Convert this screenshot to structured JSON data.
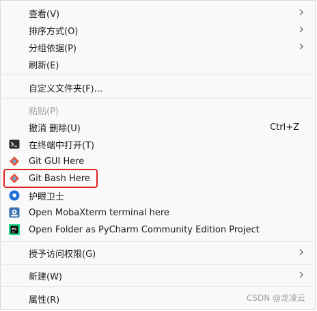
{
  "menu": {
    "view": {
      "label": "查看(V)",
      "icon": "chevron-right-icon"
    },
    "sort_by": {
      "label": "排序方式(O)",
      "icon": "chevron-right-icon"
    },
    "group_by": {
      "label": "分组依据(P)",
      "icon": "chevron-right-icon"
    },
    "refresh": {
      "label": "刷新(E)"
    },
    "customize_folder": {
      "label": "自定义文件夹(F)..."
    },
    "paste": {
      "label": "粘贴(P)",
      "disabled": true
    },
    "undo_delete": {
      "label": "撤消 删除(U)",
      "shortcut": "Ctrl+Z"
    },
    "open_in_terminal": {
      "label": "在终端中打开(T)",
      "icon": "terminal-icon"
    },
    "git_gui": {
      "label": "Git GUI Here",
      "icon": "git-icon"
    },
    "git_bash": {
      "label": "Git Bash Here",
      "icon": "git-icon",
      "highlight_color": "#e02020"
    },
    "eye_guard": {
      "label": "护眼卫士",
      "icon": "eye-guard-icon"
    },
    "mobaxterm": {
      "label": "Open MobaXterm terminal here",
      "icon": "mobaxterm-icon"
    },
    "pycharm": {
      "label": "Open Folder as PyCharm Community Edition Project",
      "icon": "pycharm-icon"
    },
    "grant_access": {
      "label": "授予访问权限(G)",
      "icon": "chevron-right-icon"
    },
    "new": {
      "label": "新建(W)",
      "icon": "chevron-right-icon"
    },
    "properties": {
      "label": "属性(R)"
    }
  },
  "watermark": "CSDN @龙凌云"
}
